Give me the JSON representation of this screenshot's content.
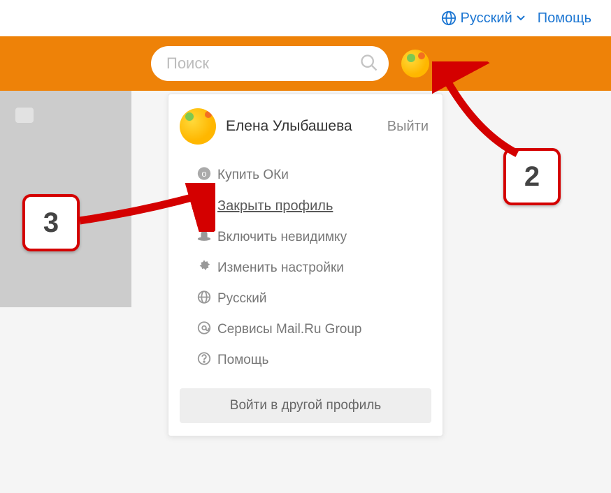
{
  "topbar": {
    "language": "Русский",
    "help": "Помощь"
  },
  "search": {
    "placeholder": "Поиск"
  },
  "dropdown": {
    "user_name": "Елена Улыбашева",
    "exit": "Выйти",
    "items": [
      {
        "label": "Купить ОКи",
        "icon": "coin-icon"
      },
      {
        "label": "Закрыть профиль",
        "icon": "lock-icon",
        "highlight": true
      },
      {
        "label": "Включить невидимку",
        "icon": "hat-icon"
      },
      {
        "label": "Изменить настройки",
        "icon": "gear-icon"
      },
      {
        "label": "Русский",
        "icon": "globe-icon"
      },
      {
        "label": "Сервисы Mail.Ru Group",
        "icon": "at-icon"
      },
      {
        "label": "Помощь",
        "icon": "question-icon"
      }
    ],
    "footer": "Войти в другой профиль"
  },
  "callouts": {
    "two": "2",
    "three": "3"
  }
}
